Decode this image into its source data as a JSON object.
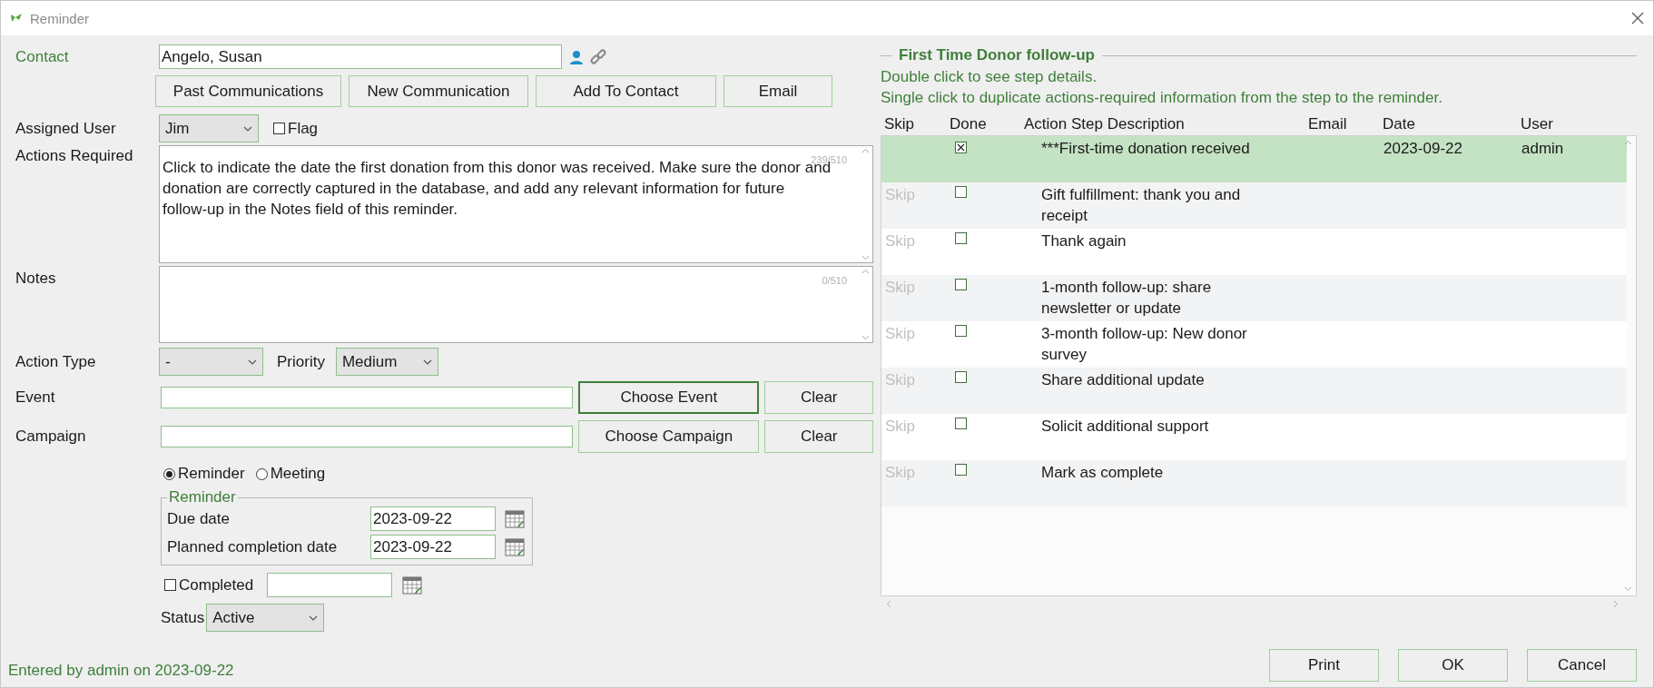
{
  "window": {
    "title": "Reminder"
  },
  "contact": {
    "label": "Contact",
    "value": "Angelo, Susan"
  },
  "contact_buttons": [
    "Past Communications",
    "New Communication",
    "Add To Contact",
    "Email"
  ],
  "assigned_user": {
    "label": "Assigned User",
    "value": "Jim"
  },
  "flag": {
    "label": "Flag",
    "checked": false
  },
  "actions_required": {
    "label": "Actions Required",
    "value": "Click to indicate the date the first donation from this donor was received. Make sure the donor and donation are correctly captured in the database, and add any relevant information for future follow-up in the Notes field of this reminder.",
    "counter": "239/510"
  },
  "notes": {
    "label": "Notes",
    "counter": "0/510"
  },
  "action_type": {
    "label": "Action Type",
    "value": "-"
  },
  "priority": {
    "label": "Priority",
    "value": "Medium"
  },
  "event": {
    "label": "Event",
    "choose": {
      "label": "Choose Event",
      "focused": true
    },
    "clear": "Clear"
  },
  "campaign": {
    "label": "Campaign",
    "choose": {
      "label": "Choose Campaign",
      "focused": false
    },
    "clear": "Clear"
  },
  "modes": [
    {
      "label": "Reminder",
      "selected": true
    },
    {
      "label": "Meeting",
      "selected": false
    }
  ],
  "reminder_group": {
    "title": "Reminder",
    "dates": [
      {
        "label": "Due date",
        "value": "2023-09-22"
      },
      {
        "label": "Planned completion date",
        "value": "2023-09-22"
      }
    ]
  },
  "completed": {
    "label": "Completed",
    "checked": false
  },
  "status": {
    "label": "Status",
    "value": "Active"
  },
  "entered_by": "Entered by admin on 2023-09-22",
  "steps": {
    "title": "First Time Donor follow-up",
    "hints": [
      "Double click to see step details.",
      "Single click to duplicate actions-required information from the step to the reminder."
    ],
    "columns": [
      "Skip",
      "Done",
      "Action Step Description",
      "Email",
      "Date",
      "User"
    ],
    "rows": [
      {
        "skip": "",
        "done": true,
        "description": "***First-time donation received",
        "date": "2023-09-22",
        "user": "admin",
        "selected": true
      },
      {
        "skip": "Skip",
        "done": false,
        "description": "Gift fulfillment: thank you and receipt",
        "selected": false
      },
      {
        "skip": "Skip",
        "done": false,
        "description": "Thank again",
        "selected": false
      },
      {
        "skip": "Skip",
        "done": false,
        "description": "1-month follow-up: share newsletter or update",
        "selected": false
      },
      {
        "skip": "Skip",
        "done": false,
        "description": "3-month follow-up: New donor survey",
        "selected": false
      },
      {
        "skip": "Skip",
        "done": false,
        "description": "Share additional update",
        "selected": false
      },
      {
        "skip": "Skip",
        "done": false,
        "description": "Solicit additional support",
        "selected": false
      },
      {
        "skip": "Skip",
        "done": false,
        "description": "Mark as complete",
        "selected": false
      }
    ]
  },
  "footer_buttons": [
    "Print",
    "OK",
    "Cancel"
  ]
}
